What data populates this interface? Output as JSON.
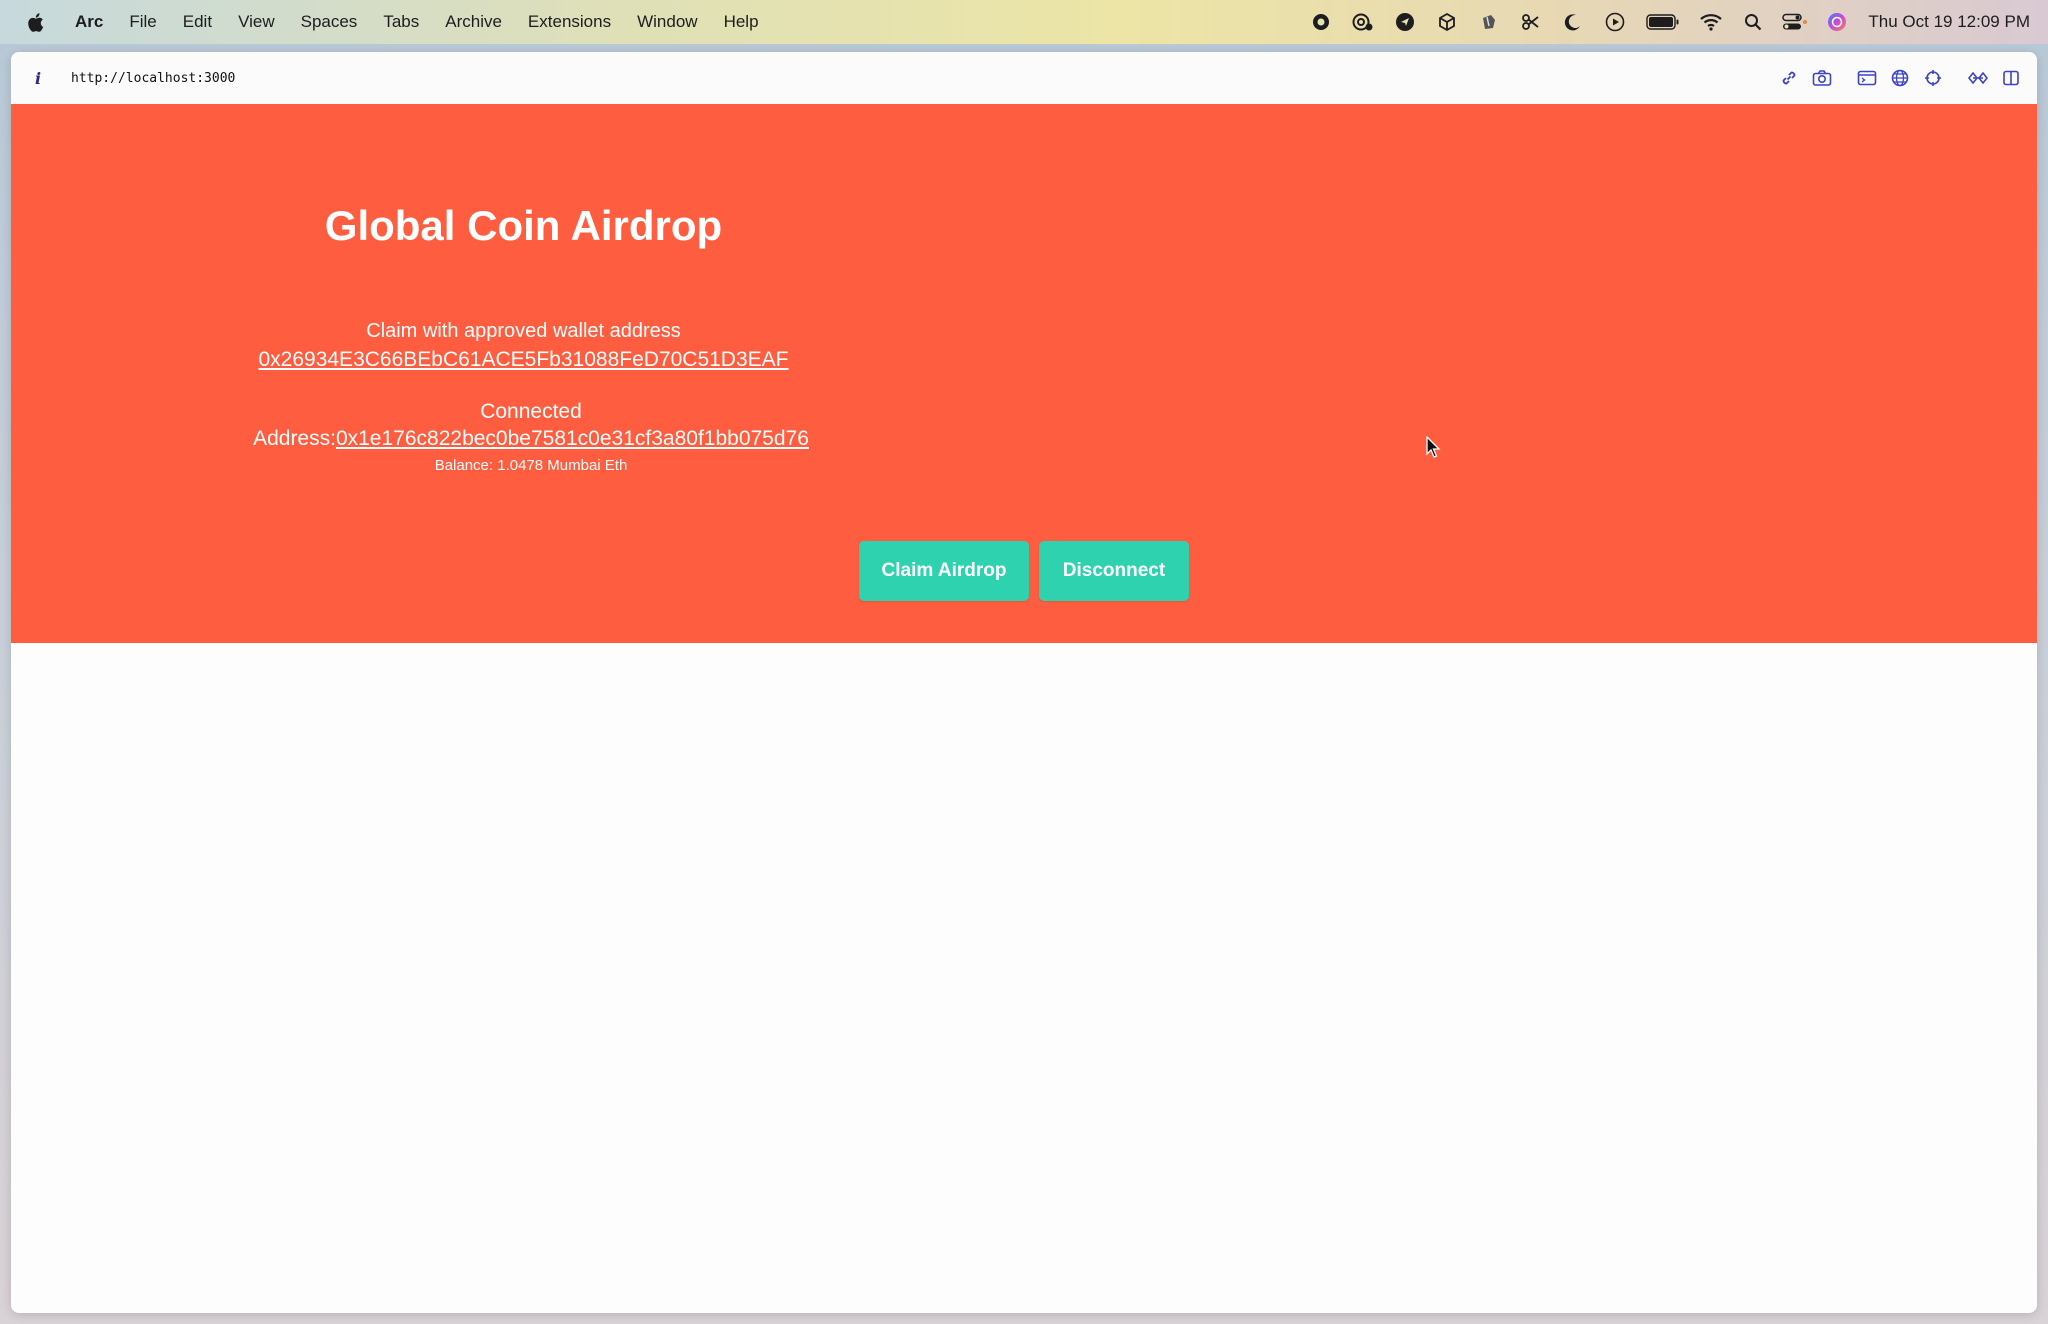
{
  "menubar": {
    "app_name": "Arc",
    "items": [
      "File",
      "Edit",
      "View",
      "Spaces",
      "Tabs",
      "Archive",
      "Extensions",
      "Window",
      "Help"
    ],
    "clock": "Thu Oct 19  12:09 PM"
  },
  "browser": {
    "url": "http://localhost:3000",
    "info_glyph": "i"
  },
  "page": {
    "title": "Global Coin Airdrop",
    "subtitle": "Claim with approved wallet address",
    "approved_address": "0x26934E3C66BEbC61ACE5Fb31088FeD70C51D3EAF",
    "connected_label": "Connected",
    "address_label": "Address:",
    "connected_address": "0x1e176c822bec0be7581c0e31cf3a80f1bb075d76",
    "balance": "Balance: 1.0478 Mumbai Eth",
    "claim_button": "Claim Airdrop",
    "disconnect_button": "Disconnect"
  },
  "colors": {
    "hero_bg": "#ff5d3f",
    "button_bg": "#2fd2ae",
    "text": "#ffffff"
  }
}
